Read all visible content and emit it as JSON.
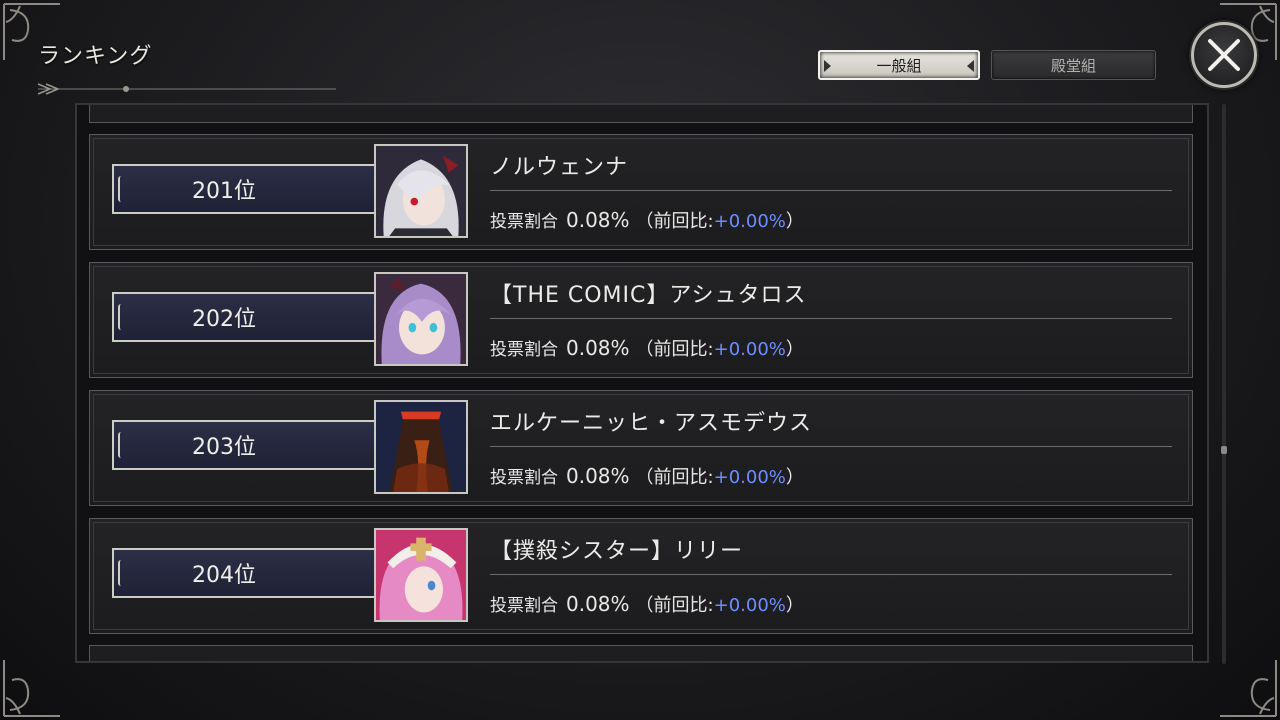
{
  "header": {
    "title": "ランキング"
  },
  "tabs": [
    {
      "label": "一般組",
      "active": true
    },
    {
      "label": "殿堂組",
      "active": false
    }
  ],
  "close_icon": "close-x-icon",
  "colors": {
    "diff_positive": "#6f8cff",
    "rank_plate": "#24263c",
    "frame_silver": "#cfcdc7"
  },
  "ranking": [
    {
      "rank": "201位",
      "name": "ノルウェンナ",
      "vote_label": "投票割合",
      "percent": "0.08%",
      "diff_open": "（前回比:",
      "diff": "+0.00%",
      "diff_close": "）",
      "portrait": "white-haired-girl-portrait"
    },
    {
      "rank": "202位",
      "name": "【THE COMIC】アシュタロス",
      "vote_label": "投票割合",
      "percent": "0.08%",
      "diff_open": "（前回比:",
      "diff": "+0.00%",
      "diff_close": "）",
      "portrait": "purple-haired-girl-portrait"
    },
    {
      "rank": "203位",
      "name": "エルケーニッヒ・アスモデウス",
      "vote_label": "投票割合",
      "percent": "0.08%",
      "diff_open": "（前回比:",
      "diff": "+0.00%",
      "diff_close": "）",
      "portrait": "dark-cloaked-figure-portrait"
    },
    {
      "rank": "204位",
      "name": "【撲殺シスター】リリー",
      "vote_label": "投票割合",
      "percent": "0.08%",
      "diff_open": "（前回比:",
      "diff": "+0.00%",
      "diff_close": "）",
      "portrait": "pink-haired-nun-portrait"
    }
  ]
}
